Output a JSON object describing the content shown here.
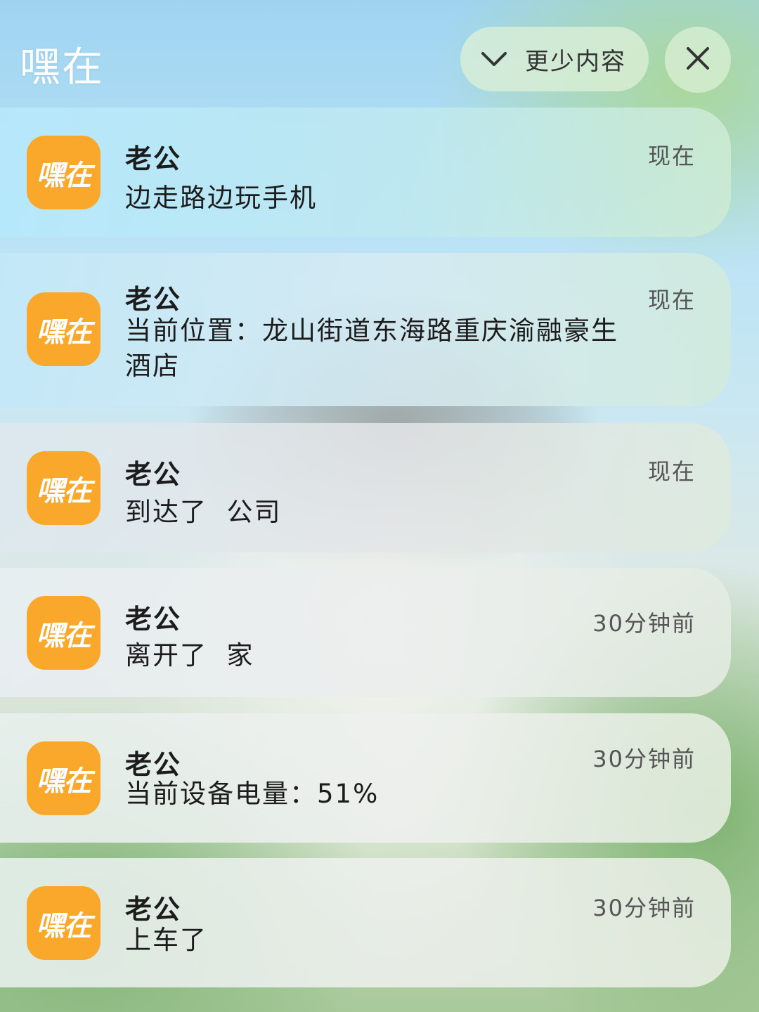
{
  "header": {
    "app_title": "嘿在",
    "show_less_label": "更少内容",
    "close_icon": "close-icon",
    "chevron_icon": "chevron-down-icon"
  },
  "app_icon_text": "嘿在",
  "colors": {
    "icon_bg": "#f9a82b",
    "icon_text": "#ffffff"
  },
  "notifications": [
    {
      "sender": "老公",
      "message": "边走路边玩手机",
      "time": "现在"
    },
    {
      "sender": "老公",
      "message": "当前位置：龙山街道东海路重庆渝融豪生酒店",
      "time": "现在"
    },
    {
      "sender": "老公",
      "message": "到达了  公司",
      "time": "现在"
    },
    {
      "sender": "老公",
      "message": "离开了  家",
      "time": "30分钟前"
    },
    {
      "sender": "老公",
      "message": "当前设备电量：51%",
      "time": "30分钟前"
    },
    {
      "sender": "老公",
      "message": "上车了",
      "time": "30分钟前"
    }
  ]
}
